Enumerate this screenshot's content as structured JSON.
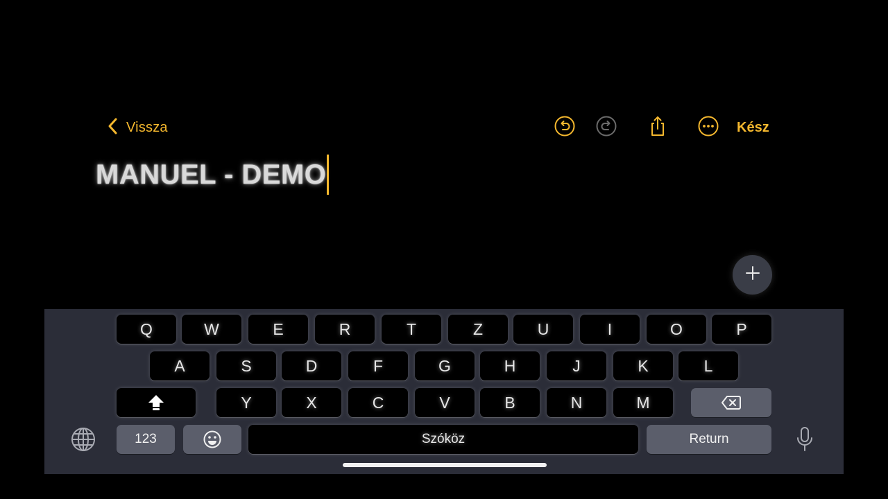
{
  "nav": {
    "back_label": "Vissza",
    "done_label": "Kész",
    "accent_color": "#f5b82e"
  },
  "note": {
    "title": "MANUEL - DEMO"
  },
  "keyboard": {
    "row1": [
      "Q",
      "W",
      "E",
      "R",
      "T",
      "Z",
      "U",
      "I",
      "O",
      "P"
    ],
    "row2": [
      "A",
      "S",
      "D",
      "F",
      "G",
      "H",
      "J",
      "K",
      "L"
    ],
    "row3": [
      "Y",
      "X",
      "C",
      "V",
      "B",
      "N",
      "M"
    ],
    "numbers_label": "123",
    "space_label": "Szóköz",
    "return_label": "Return"
  },
  "icons": {
    "back": "chevron-left-icon",
    "undo": "undo-icon",
    "redo": "redo-icon",
    "share": "share-icon",
    "more": "more-icon",
    "add": "plus-icon",
    "shift": "shift-icon",
    "backspace": "backspace-icon",
    "globe": "globe-icon",
    "emoji": "emoji-icon",
    "mic": "microphone-icon"
  }
}
